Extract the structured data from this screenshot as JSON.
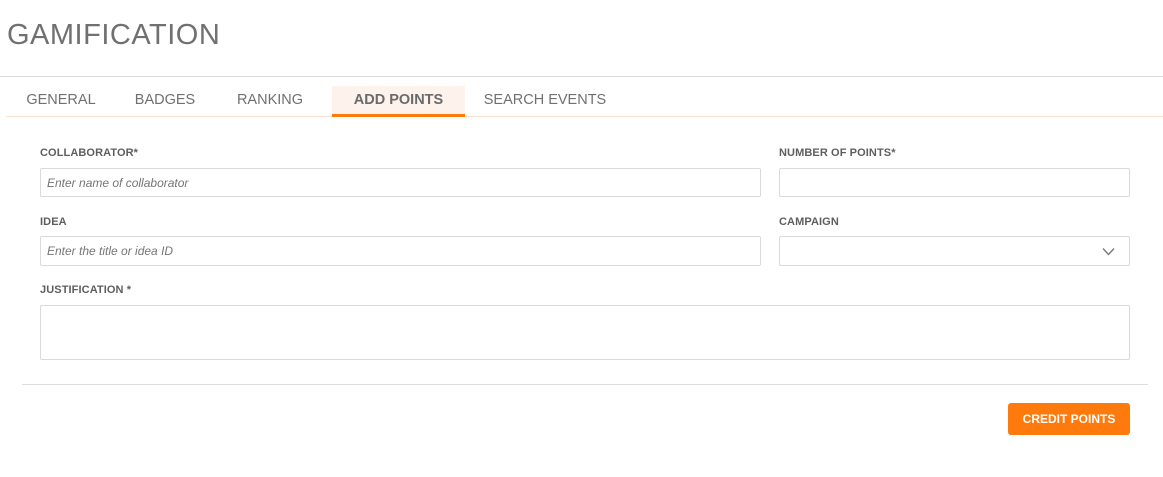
{
  "page": {
    "title": "GAMIFICATION"
  },
  "tabs": [
    {
      "label": "GENERAL",
      "active": false
    },
    {
      "label": "BADGES",
      "active": false
    },
    {
      "label": "RANKING",
      "active": false
    },
    {
      "label": "ADD POINTS",
      "active": true
    },
    {
      "label": "SEARCH EVENTS",
      "active": false
    }
  ],
  "form": {
    "collaborator": {
      "label": "COLLABORATOR*",
      "placeholder": "Enter name of collaborator",
      "value": ""
    },
    "points": {
      "label": "NUMBER OF POINTS*",
      "value": ""
    },
    "idea": {
      "label": "IDEA",
      "placeholder": "Enter the title or idea ID",
      "value": ""
    },
    "campaign": {
      "label": "CAMPAIGN",
      "value": ""
    },
    "justification": {
      "label": "JUSTIFICATION *",
      "value": ""
    }
  },
  "actions": {
    "submit_label": "CREDIT POINTS"
  },
  "colors": {
    "accent": "#ff7a0c",
    "tab_active_bg": "#fdf3ec"
  },
  "icons": {
    "campaign_dropdown": "chevron-down-icon"
  }
}
